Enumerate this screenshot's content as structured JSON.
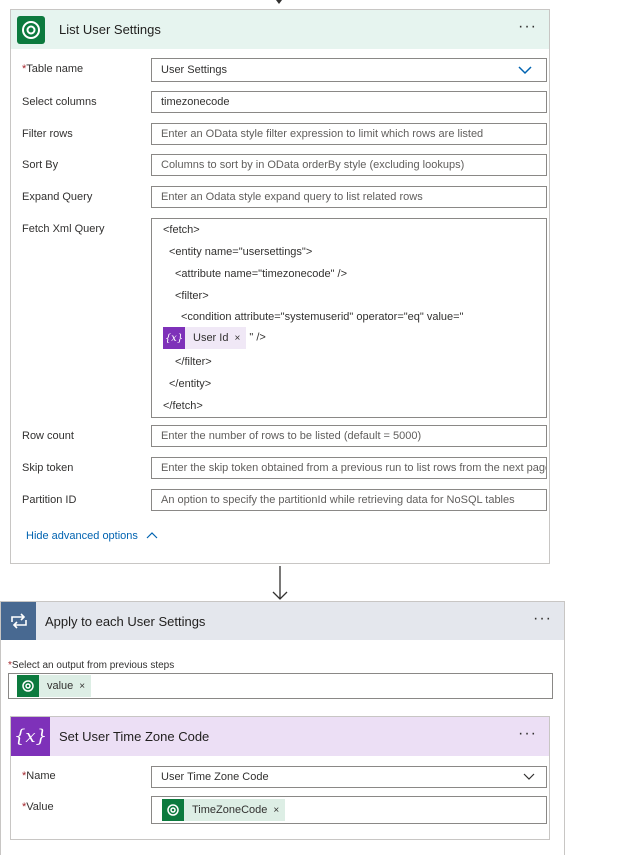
{
  "list_action": {
    "title": "List User Settings",
    "menu": "···",
    "fields": {
      "table_name": {
        "label": "Table name",
        "value": "User Settings"
      },
      "select_columns": {
        "label": "Select columns",
        "value": "timezonecode"
      },
      "filter_rows": {
        "label": "Filter rows",
        "placeholder": "Enter an OData style filter expression to limit which rows are listed"
      },
      "sort_by": {
        "label": "Sort By",
        "placeholder": "Columns to sort by in OData orderBy style (excluding lookups)"
      },
      "expand_query": {
        "label": "Expand Query",
        "placeholder": "Enter an Odata style expand query to list related rows"
      },
      "fetch_xml": {
        "label": "Fetch Xml Query",
        "lines": [
          "<fetch>",
          "<entity name=\"usersettings\">",
          "<attribute name=\"timezonecode\" />",
          "<filter>",
          "<condition attribute=\"systemuserid\" operator=\"eq\" value=\"",
          "\" />",
          "</filter>",
          "</entity>",
          "</fetch>"
        ],
        "token": {
          "label": "User Id",
          "icon": "{x}",
          "remove": "×"
        }
      },
      "row_count": {
        "label": "Row count",
        "placeholder": "Enter the number of rows to be listed (default = 5000)"
      },
      "skip_token": {
        "label": "Skip token",
        "placeholder": "Enter the skip token obtained from a previous run to list rows from the next page"
      },
      "partition_id": {
        "label": "Partition ID",
        "placeholder": "An option to specify the partitionId while retrieving data for NoSQL tables"
      }
    },
    "required_mark": "*",
    "advanced_link": "Hide advanced options"
  },
  "apply_each": {
    "title": "Apply to each User Settings",
    "menu": "···",
    "select_label": "Select an output from previous steps",
    "token": {
      "label": "value",
      "remove": "×"
    }
  },
  "set_variable": {
    "title": "Set User Time Zone Code",
    "menu": "···",
    "icon": "{x}",
    "name": {
      "label": "Name",
      "value": "User Time Zone Code"
    },
    "value": {
      "label": "Value",
      "token": "TimeZoneCode",
      "remove": "×"
    }
  },
  "colors": {
    "dataverse_green": "#0c7a3e",
    "variable_purple": "#7e31b9",
    "loop_blue": "#486991",
    "link_blue": "#0063b1"
  }
}
